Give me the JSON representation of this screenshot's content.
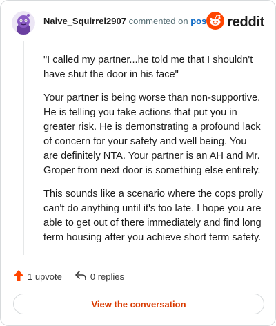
{
  "header": {
    "username": "Naive_Squirrel2907",
    "commented_text": "commented on",
    "post_link": "post",
    "brand_name": "reddit",
    "brand_color": "#ff4500"
  },
  "comment": {
    "paragraphs": [
      "\"I called my partner...he told me that I shouldn't have shut the door in his face\"",
      "Your partner is being worse than non-supportive. He is telling you take actions that put you in greater risk. He is demonstrating a profound lack of concern for your safety and well being. You are definitely NTA. Your partner is an AH and Mr. Groper from next door is something else entirely.",
      "This sounds like a scenario where the cops prolly can't do anything until it's too late. I hope you are able to get out of there immediately and find long term housing after you achieve short term safety."
    ]
  },
  "actions": {
    "upvote_label": "1 upvote",
    "replies_label": "0 replies",
    "upvote_color": "#ff4500"
  },
  "cta": {
    "label": "View the conversation",
    "color": "#d93a00"
  },
  "icons": {
    "avatar": "snoo-avatar-icon",
    "brand": "reddit-logo-icon",
    "upvote": "upvote-arrow-icon",
    "reply": "reply-arrow-icon"
  }
}
